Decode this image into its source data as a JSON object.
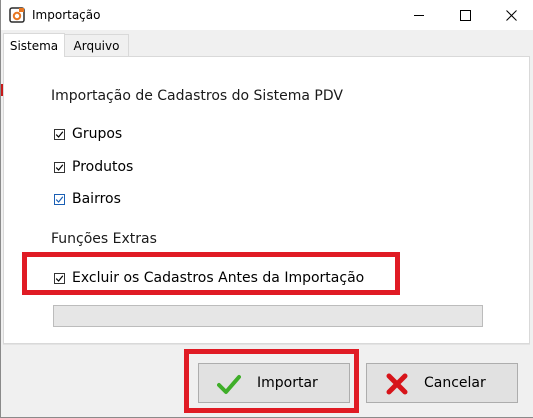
{
  "window": {
    "title": "Importação",
    "controls": [
      "minimize-icon",
      "maximize-icon",
      "close-icon"
    ]
  },
  "tabs": [
    {
      "label": "Sistema",
      "active": true
    },
    {
      "label": "Arquivo",
      "active": false
    }
  ],
  "sections": {
    "import_title": "Importação de Cadastros do Sistema PDV",
    "extras_title": "Funções Extras"
  },
  "checkboxes": [
    {
      "label": "Grupos",
      "checked": true
    },
    {
      "label": "Produtos",
      "checked": true
    },
    {
      "label": "Bairros",
      "checked": true
    }
  ],
  "extras": {
    "delete_before": {
      "label": "Excluir os Cadastros Antes da Importação",
      "checked": true
    }
  },
  "buttons": {
    "import_label": "Importar",
    "cancel_label": "Cancelar"
  },
  "colors": {
    "highlight": "#e01b24",
    "check_green": "#3fae29",
    "cancel_red": "#d7141a",
    "app_icon": "#e87722"
  }
}
